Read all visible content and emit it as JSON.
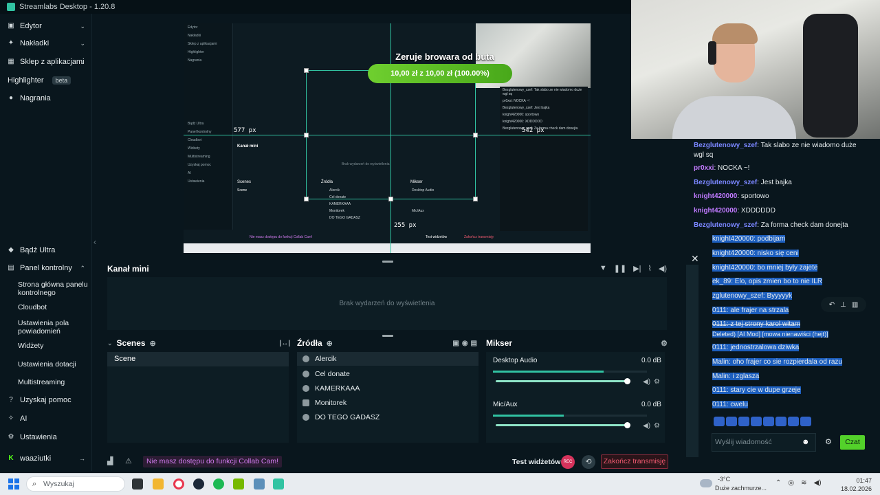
{
  "window": {
    "title": "Streamlabs Desktop - 1.20.8"
  },
  "sidebar": {
    "top_items": [
      {
        "label": "Edytor",
        "icon": "editor-icon"
      },
      {
        "label": "Nakładki",
        "icon": "overlays-icon"
      },
      {
        "label": "Sklep z aplikacjami",
        "icon": "app-store-icon"
      },
      {
        "label": "Highlighter",
        "icon": "highlighter-icon",
        "badge": "beta"
      },
      {
        "label": "Nagrania",
        "icon": "recordings-icon"
      }
    ],
    "ultra_label": "Bądź Ultra",
    "dashboard_label": "Panel kontrolny",
    "dashboard_subitems": [
      "Strona główna panelu kontrolnego",
      "Cloudbot",
      "Ustawienia pola powiadomień",
      "Widżety",
      "Ustawienia dotacji",
      "Multistreaming"
    ],
    "help_label": "Uzyskaj pomoc",
    "ai_label": "AI",
    "settings_label": "Ustawienia",
    "user_label": "waaziutki"
  },
  "preview": {
    "donation_title": "Zeruje browara od buta",
    "donation_progress_text": "10,00 zł z 10,00 zł (100.00%)",
    "donation_fraction": 1.0,
    "guide_labels": [
      "577 px",
      "542 px",
      "255 px"
    ],
    "nested_labels": {
      "side_items": [
        "Edytor",
        "Nakładki",
        "Sklep z aplikacjami",
        "Highlighter",
        "Nagrania",
        "Bądź Ultra",
        "Panel kontrolny",
        "Cloudbot",
        "Widżety",
        "Multistreaming",
        "Uzyskaj pomoc",
        "AI",
        "Ustawienia"
      ],
      "mini_title": "Kanał mini",
      "mini_empty": "Brak wydarzeń do wyświetlenia",
      "scenes": "Scenes",
      "scene_row": "Scene",
      "sources": "Źródła",
      "mixer": "Mikser",
      "sources_list": [
        "Alercik",
        "Cel donate",
        "KAMERKAAA",
        "Monitorek",
        "DO TEGO GADASZ"
      ],
      "mixer_rows": [
        "Desktop Audio",
        "Mic/Aux"
      ],
      "collab": "Nie masz dostępu do funkcji Collab Cam!",
      "test_widgets": "Test widżetów",
      "end_stream": "Zakończ transmisję",
      "chat_lines": [
        "Bezglutenowy_szef: Tak slabo ze nie wiadomo duże wgl sq",
        "pr0xxi: NOCKA ~!",
        "Bezglutenowy_szef: Jest bajka",
        "knight420000: sportowo",
        "knight420000: XDDDDDD",
        "Bezglutenowy_szef: Za forma check dam donejta"
      ]
    }
  },
  "mini_feed": {
    "title": "Kanał mini",
    "empty_text": "Brak wydarzeń do wyświetlenia"
  },
  "scenes": {
    "title": "Scenes",
    "items": [
      "Scene"
    ]
  },
  "sources": {
    "title": "Źródła",
    "items": [
      "Alercik",
      "Cel donate",
      "KAMERKAAA",
      "Monitorek",
      "DO TEGO GADASZ"
    ]
  },
  "mixer": {
    "title": "Mikser",
    "channels": [
      {
        "name": "Desktop Audio",
        "db": "0.0 dB",
        "level": 0.72,
        "volume": 1.0
      },
      {
        "name": "Mic/Aux",
        "db": "0.0 dB",
        "level": 0.46,
        "volume": 1.0
      }
    ]
  },
  "footer": {
    "collab_notice": "Nie masz dostępu do funkcji Collab Cam!",
    "test_widgets": "Test widżetów",
    "rec_label": "REC",
    "end_stream": "Zakończ transmisję"
  },
  "chat": {
    "messages": [
      {
        "user": "Bezglutenowy_szef",
        "text": ": Tak slabo ze nie wiadomo duże wgl sq",
        "color": "#7a86ff"
      },
      {
        "user": "pr0xxi",
        "text": ": NOCKA ~!",
        "color": "#c47bff"
      },
      {
        "user": "Bezglutenowy_szef",
        "text": ": Jest bajka",
        "color": "#7a86ff"
      },
      {
        "user": "knight420000",
        "text": ": sportowo",
        "color": "#c07aff"
      },
      {
        "user": "knight420000",
        "text": ": XDDDDDD",
        "color": "#c07aff"
      },
      {
        "user": "Bezglutenowy_szef",
        "text": ": Za forma check dam donejta",
        "color": "#7a86ff"
      }
    ],
    "selected_messages": [
      "knight420000: podbijam",
      "knight420000: nisko się ceni",
      "knight420000: bo mniej były zajete",
      "ek_89: Elo, opis zmien bo to nie ILR",
      "zglutenowy_szef: Byyyyyk",
      "0111: ale frajer na strzala",
      "0111: z tej strony karol witam",
      "Deleted) [AI Mod] [mowa nienawiści (hejt)]",
      "0111: jednostrzalowa dziwka",
      "Malin: oho frajer co sie rozpierdala od razu",
      "Malin: i zglasza",
      "0111: stary cie w dupe grzeje",
      "0111: cwelu"
    ],
    "input_placeholder": "Wyślij wiadomość",
    "send_label": "Czat"
  },
  "taskbar": {
    "search_placeholder": "Wyszukaj",
    "weather_temp": "-3°C",
    "weather_desc": "Duże zachmurze...",
    "time": "01:47",
    "date": "18.02.2026"
  },
  "colors": {
    "accent": "#31c3a2",
    "send": "#53d12a",
    "danger": "#f15a70",
    "collab": "#d37cf0"
  }
}
